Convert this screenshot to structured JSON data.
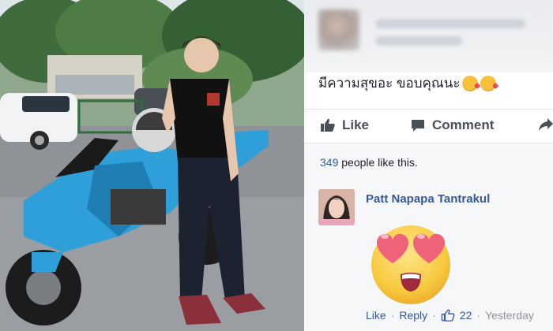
{
  "post": {
    "text": "มีความสุขอะ ขอบคุณนะ",
    "emoji": [
      "kissing-heart-emoji",
      "kissing-heart-emoji"
    ]
  },
  "actions": {
    "like_label": "Like",
    "comment_label": "Comment"
  },
  "likes": {
    "count": "349",
    "suffix": "people like this."
  },
  "comment": {
    "author": "Patt Napapa Tantrakul",
    "emoji": "heart-eyes-emoji",
    "like_label": "Like",
    "reply_label": "Reply",
    "like_count": "22",
    "time": "Yesterday"
  },
  "colors": {
    "link": "#365899",
    "text": "#1d2129",
    "muted": "#90949c",
    "action": "#4b4f56",
    "bike_blue": "#2e9fd8"
  }
}
